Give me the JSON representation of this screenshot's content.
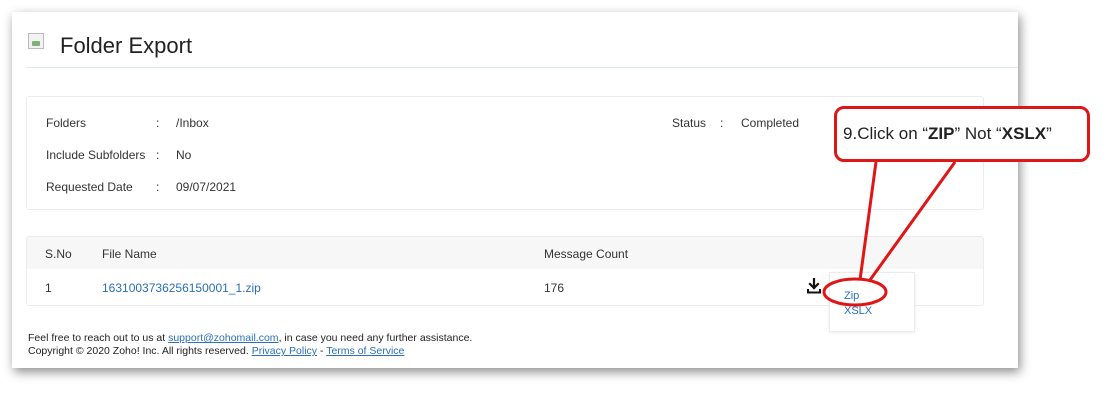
{
  "page": {
    "title": "Folder Export",
    "header_image": "broken-image-icon"
  },
  "details": {
    "folders_label": "Folders",
    "folders_value": "/Inbox",
    "subfolders_label": "Include Subfolders",
    "subfolders_value": "No",
    "requested_label": "Requested Date",
    "requested_value": "09/07/2021",
    "separator": ":",
    "status_label": "Status",
    "status_value": "Completed"
  },
  "table": {
    "columns": [
      "S.No",
      "File Name",
      "Message Count"
    ],
    "rows": [
      {
        "sno": "1",
        "file_name": "1631003736256150001_1.zip",
        "message_count": "176"
      }
    ],
    "download_icon": "download-icon"
  },
  "download_menu": {
    "items": [
      "Zip",
      "XSLX"
    ]
  },
  "footer": {
    "line1_prefix": "Feel free to reach out to us at ",
    "support_email": "support@zohomail.com",
    "line1_suffix": ", in case you need any further assistance.",
    "line2_prefix": "Copyright © 2020 Zoho! Inc. All rights reserved. ",
    "privacy_link": "Privacy Policy",
    "link_separator": " - ",
    "terms_link": "Terms of Service"
  },
  "annotation": {
    "step": "9.",
    "text_1": " Click on “",
    "bold_1": "ZIP",
    "text_2": "” Not “",
    "bold_2": "XSLX",
    "text_3": "”",
    "color": "#e01515"
  },
  "colors": {
    "link": "#2a6fb7",
    "header_bg": "#f7f7f7",
    "annotation": "#e01515"
  }
}
